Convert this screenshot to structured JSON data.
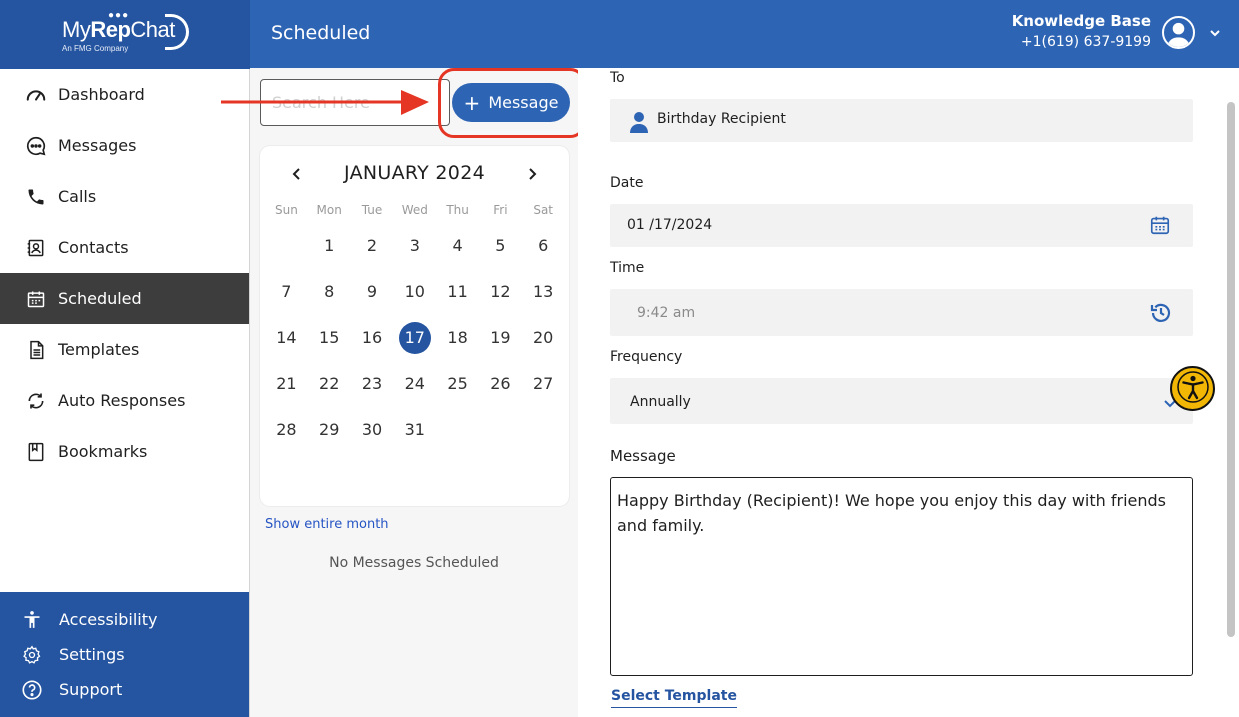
{
  "brand": {
    "name_light_1": "My",
    "name_bold": "Rep",
    "name_light_2": "Chat",
    "tagline": "An FMG Company"
  },
  "header": {
    "title": "Scheduled",
    "user_name": "Knowledge Base",
    "user_phone": "+1(619) 637-9199"
  },
  "sidebar": {
    "items": [
      {
        "label": "Dashboard",
        "icon": "speedometer-icon",
        "active": false
      },
      {
        "label": "Messages",
        "icon": "chat-bubble-icon",
        "active": false
      },
      {
        "label": "Calls",
        "icon": "phone-icon",
        "active": false
      },
      {
        "label": "Contacts",
        "icon": "contact-card-icon",
        "active": false
      },
      {
        "label": "Scheduled",
        "icon": "calendar-icon",
        "active": true
      },
      {
        "label": "Templates",
        "icon": "document-icon",
        "active": false
      },
      {
        "label": "Auto Responses",
        "icon": "refresh-icon",
        "active": false
      },
      {
        "label": "Bookmarks",
        "icon": "bookmark-icon",
        "active": false
      }
    ],
    "bottom": [
      {
        "label": "Accessibility",
        "icon": "accessibility-icon"
      },
      {
        "label": "Settings",
        "icon": "gear-icon"
      },
      {
        "label": "Support",
        "icon": "help-icon"
      }
    ]
  },
  "middle": {
    "search_placeholder": "Search Here",
    "message_button": "Message",
    "calendar": {
      "month_label": "JANUARY 2024",
      "weekdays": [
        "Sun",
        "Mon",
        "Tue",
        "Wed",
        "Thu",
        "Fri",
        "Sat"
      ],
      "weeks": [
        [
          "",
          "1",
          "2",
          "3",
          "4",
          "5",
          "6"
        ],
        [
          "7",
          "8",
          "9",
          "10",
          "11",
          "12",
          "13"
        ],
        [
          "14",
          "15",
          "16",
          "17",
          "18",
          "19",
          "20"
        ],
        [
          "21",
          "22",
          "23",
          "24",
          "25",
          "26",
          "27"
        ],
        [
          "28",
          "29",
          "30",
          "31",
          "",
          "",
          ""
        ]
      ],
      "selected_day": "17"
    },
    "show_month_link": "Show entire month",
    "empty_state": "No Messages Scheduled"
  },
  "form": {
    "to_label": "To",
    "recipient": "Birthday Recipient",
    "date_label": "Date",
    "date_value": "01 /17/2024",
    "time_label": "Time",
    "time_value": "9:42 am",
    "frequency_label": "Frequency",
    "frequency_value": "Annually",
    "message_label": "Message",
    "message_text": "Happy Birthday (Recipient)! We hope you enjoy this day with friends and family.",
    "select_template": "Select Template"
  },
  "colors": {
    "brand_blue": "#2e64b4",
    "dark_blue": "#2554a0",
    "highlight_red": "#e53524",
    "active_nav": "#3d3d3d",
    "accessibility_yellow": "#f2b705"
  }
}
